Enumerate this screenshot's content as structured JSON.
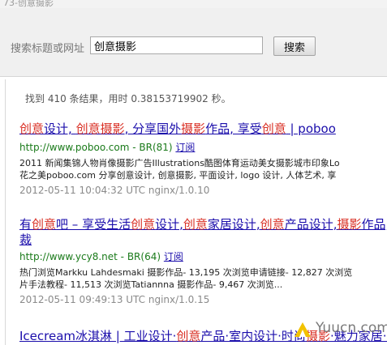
{
  "window": {
    "cut_title": "73-创意摄影"
  },
  "search": {
    "label": "搜索标题或网址",
    "value": "创意摄影",
    "button_label": "搜索"
  },
  "stats": {
    "text": "找到 410 条结果，用时 0.38153719902 秒。"
  },
  "results": [
    {
      "title_parts": [
        {
          "t": "创意",
          "hl": true
        },
        {
          "t": "设计, ",
          "hl": false
        },
        {
          "t": "创意",
          "hl": true
        },
        {
          "t": "摄影",
          "hl": true
        },
        {
          "t": ", 分享国外",
          "hl": false
        },
        {
          "t": "摄影",
          "hl": true
        },
        {
          "t": "作品, 享受",
          "hl": false
        },
        {
          "t": "创意",
          "hl": true
        },
        {
          "t": " | poboo",
          "hl": false
        }
      ],
      "url": "http://www.poboo.com - BR(81)",
      "cache_label": "订阅",
      "snippet_lines": [
        "2011 新闻集锦人物肖像摄影广告Illustrations酷图体育运动美女摄影城市印象Lo",
        "花之美poboo.com 分享创意设计, 创意摄影, 平面设计, logo 设计, 人体艺术, 享"
      ],
      "date": "2012-05-11 10:04:32 UTC nginx/1.0.10"
    },
    {
      "title_parts": [
        {
          "t": "有",
          "hl": false
        },
        {
          "t": "创意",
          "hl": true
        },
        {
          "t": "吧 – 享受生活",
          "hl": false
        },
        {
          "t": "创意",
          "hl": true
        },
        {
          "t": "设计,",
          "hl": false
        },
        {
          "t": "创意",
          "hl": true
        },
        {
          "t": "家居设计,",
          "hl": false
        },
        {
          "t": "创意",
          "hl": true
        },
        {
          "t": "产品设计,",
          "hl": false
        },
        {
          "t": "摄影",
          "hl": true
        },
        {
          "t": "作品,",
          "hl": false
        }
      ],
      "title_line2": "裁",
      "url": "http://www.ycy8.net - BR(64)",
      "cache_label": "订阅",
      "snippet_lines": [
        "热门浏览Markku Lahdesmaki 摄影作品- 13,195 次浏览申请链接- 12,827 次浏览",
        "片手法教程- 11,513 次浏览Tatiannna 摄影作品- 9,467 次浏览..."
      ],
      "date": "2012-05-11 09:49:13 UTC nginx/1.0.15"
    },
    {
      "title_parts": [
        {
          "t": "Icecream冰淇淋 | 工业设计·",
          "hl": false
        },
        {
          "t": "创意",
          "hl": true
        },
        {
          "t": "产品·室内设计·时尚",
          "hl": false
        },
        {
          "t": "摄影",
          "hl": true
        },
        {
          "t": "·魅力家居·艺",
          "hl": false
        }
      ]
    }
  ],
  "watermark": {
    "text": "Yuucn.com"
  }
}
